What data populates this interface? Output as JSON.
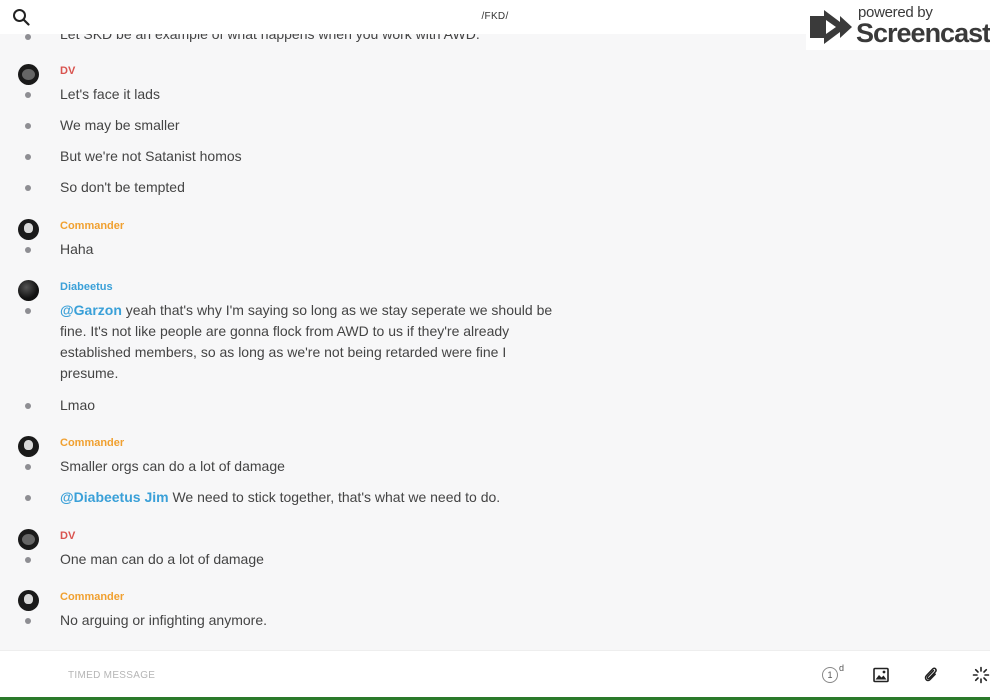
{
  "header": {
    "channel_title": "/FKD/",
    "search_icon": "search-icon",
    "phone_icon": "phone-icon",
    "info_icon": "info-icon"
  },
  "watermark": {
    "line1": "powered by",
    "line2": "Screencastify"
  },
  "cut_message": "Let SKD be an example of what happens when you work with AWD.",
  "groups": [
    {
      "author": "DV",
      "author_color": "#d9534f",
      "messages": [
        "Let's face it lads",
        "We may be smaller",
        "But we're not Satanist homos",
        "So don't be tempted"
      ]
    },
    {
      "author": "Commander",
      "author_color": "#f0a030",
      "messages": [
        "Haha"
      ]
    },
    {
      "author": "Diabeetus",
      "author_color": "#3aa0d8",
      "messages": [
        {
          "mention": "@Garzon",
          "text": " yeah that's why I'm saying so long as we stay seperate we should be fine. It's not like people are gonna flock from AWD to us if they're already established members, so as long as we're not being retarded were fine I presume."
        },
        "Lmao"
      ]
    },
    {
      "author": "Commander",
      "author_color": "#f0a030",
      "messages": [
        "Smaller orgs can do a lot of damage",
        {
          "mention": "@Diabeetus Jim",
          "text": " We need to stick together, that's what we need to do."
        }
      ]
    },
    {
      "author": "DV",
      "author_color": "#d9534f",
      "messages": [
        "One man can do a lot of damage"
      ]
    },
    {
      "author": "Commander",
      "author_color": "#f0a030",
      "messages": [
        "No arguing or infighting anymore."
      ]
    }
  ],
  "footer": {
    "timed_message_placeholder": "TIMED MESSAGE",
    "timer_value": "1",
    "timer_unit": "d",
    "image_icon": "image-icon",
    "attach_icon": "paperclip-icon",
    "spark_icon": "sparkle-icon"
  }
}
